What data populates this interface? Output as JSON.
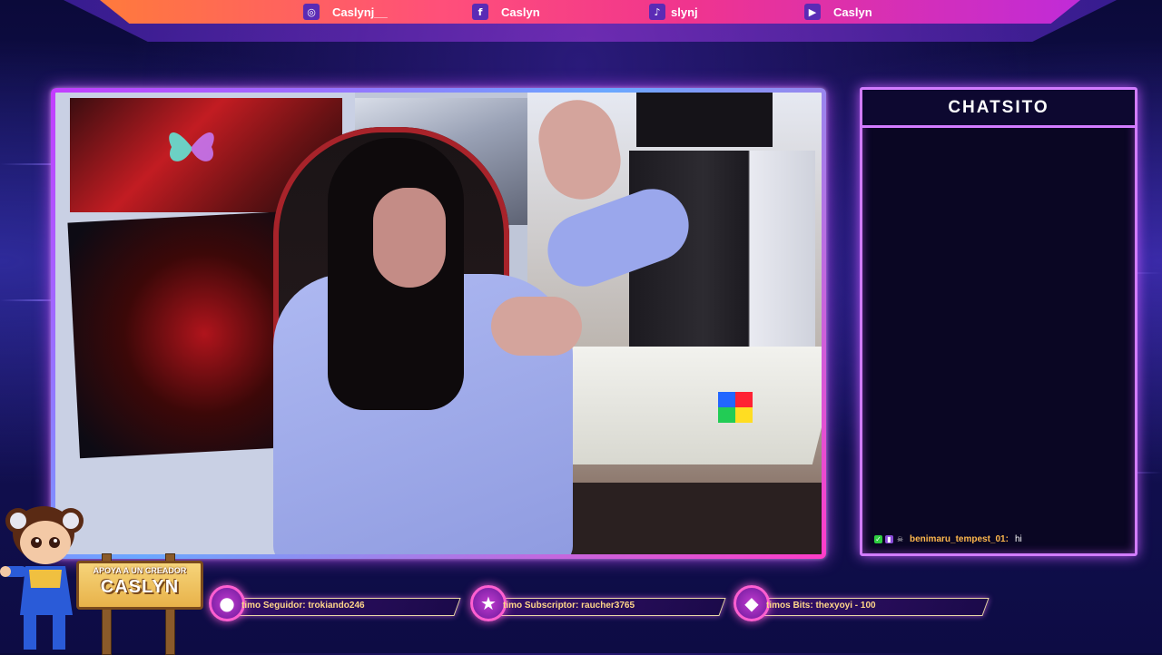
{
  "social_bar": {
    "items": [
      {
        "icon": "instagram-icon",
        "glyph": "◎",
        "name": "Caslynj__"
      },
      {
        "icon": "facebook-icon",
        "glyph": "f",
        "name": "Caslyn"
      },
      {
        "icon": "tiktok-icon",
        "glyph": "♪",
        "name": "slynj"
      },
      {
        "icon": "youtube-icon",
        "glyph": "▶",
        "name": "Caslyn"
      }
    ]
  },
  "chat": {
    "title": "CHATSITO",
    "messages": [
      {
        "user": "benimaru_tempest_01:",
        "text": "hi"
      }
    ]
  },
  "sign": {
    "small": "APOYA A UN CREADOR",
    "big": "CASLYN"
  },
  "stats": {
    "follower": "timo Seguidor: trokiando246",
    "subscriber": "timo Subscriptor: raucher3765",
    "bits": "timos Bits: thexyoyi - 100"
  },
  "colors": {
    "accent": "#d27cff",
    "topbar_start": "#ff7a3c",
    "topbar_end": "#c02bd8",
    "chat_user": "#ffb84d"
  }
}
